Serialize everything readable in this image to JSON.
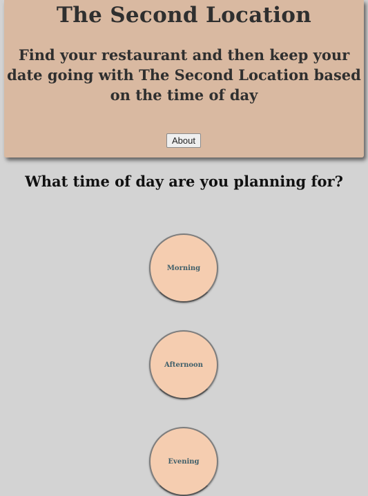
{
  "header": {
    "title": "The Second Location",
    "tagline": "Find your restaurant and then keep your date going with The Second Location based on the time of day",
    "about_label": "About"
  },
  "main": {
    "question": "What time of day are you planning for?",
    "options": [
      {
        "label": "Morning"
      },
      {
        "label": "Afternoon"
      },
      {
        "label": "Evening"
      }
    ]
  },
  "colors": {
    "page_background": "#d3d3d3",
    "header_background": "#d9b9a1",
    "option_fill": "#f5cdb0",
    "option_text": "#3f5f6a"
  }
}
